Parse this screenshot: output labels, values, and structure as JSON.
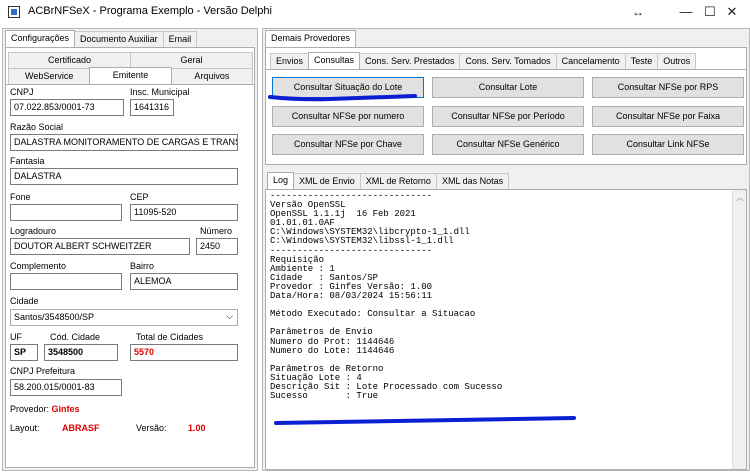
{
  "window": {
    "title": "ACBrNFSeX - Programa Exemplo - Versão Delphi",
    "resize_glyph": "↔",
    "minimize_glyph": "—",
    "maximize_glyph": "☐",
    "close_glyph": "✕"
  },
  "left": {
    "top_tabs": [
      "Configurações",
      "Documento Auxiliar",
      "Email"
    ],
    "sub_tabs_row1": [
      "Certificado",
      "Geral"
    ],
    "sub_tabs_row2": [
      "WebService",
      "Emitente",
      "Arquivos"
    ],
    "fields": {
      "cnpj_label": "CNPJ",
      "cnpj_value": "07.022.853/0001-73",
      "insc_label": "Insc. Municipal",
      "insc_value": "1641316",
      "razao_label": "Razão Social",
      "razao_value": "DALASTRA MONITORAMENTO DE CARGAS E TRANS",
      "fantasia_label": "Fantasia",
      "fantasia_value": "DALASTRA",
      "fone_label": "Fone",
      "fone_value": "",
      "cep_label": "CEP",
      "cep_value": "11095-520",
      "logradouro_label": "Logradouro",
      "logradouro_value": "DOUTOR ALBERT SCHWEITZER",
      "numero_label": "Número",
      "numero_value": "2450",
      "complemento_label": "Complemento",
      "complemento_value": "",
      "bairro_label": "Bairro",
      "bairro_value": "ALEMOA",
      "cidade_label": "Cidade",
      "cidade_value": "Santos/3548500/SP",
      "uf_label": "UF",
      "uf_value": "SP",
      "cod_cidade_label": "Cód. Cidade",
      "cod_cidade_value": "3548500",
      "total_cidades_label": "Total de Cidades",
      "total_cidades_value": "5570",
      "cnpj_pref_label": "CNPJ Prefeitura",
      "cnpj_pref_value": "58.200.015/0001-83",
      "provedor_label": "Provedor:",
      "provedor_value": "Ginfes",
      "layout_label": "Layout:",
      "layout_value": "ABRASF",
      "versao_label": "Versão:",
      "versao_value": "1.00"
    }
  },
  "right": {
    "top_tab": "Demais Provedores",
    "tabs": [
      "Envios",
      "Consultas",
      "Cons. Serv. Prestados",
      "Cons. Serv. Tomados",
      "Cancelamento",
      "Teste",
      "Outros"
    ],
    "buttons": [
      [
        "Consultar Situação do Lote",
        "Consultar Lote",
        "Consultar NFSe por RPS"
      ],
      [
        "Consultar NFSe por numero",
        "Consultar NFSe por Período",
        "Consultar NFSe por Faixa"
      ],
      [
        "Consultar NFSe por Chave",
        "Consultar NFSe Genérico",
        "Consultar Link NFSe"
      ]
    ],
    "log_tabs": [
      "Log",
      "XML de Envio",
      "XML de Retorno",
      "XML das Notas"
    ],
    "log_text": "------------------------------\nVersão OpenSSL\nOpenSSL 1.1.1j  16 Feb 2021\n01.01.01.0AF\nC:\\Windows\\SYSTEM32\\libcrypto-1_1.dll\nC:\\Windows\\SYSTEM32\\libssl-1_1.dll\n------------------------------\nRequisição\nAmbiente : 1\nCidade   : Santos/SP\nProvedor : Ginfes Versão: 1.00\nData/Hora: 08/03/2024 15:56:11\n\nMétodo Executado: Consultar a Situacao\n\nParâmetros de Envio\nNumero do Prot: 1144646\nNumero do Lote: 1144646\n\nParâmetros de Retorno\nSituação Lote : 4\nDescrição Sit : Lote Processado com Sucesso\nSucesso       : True"
  },
  "colors": {
    "annotation_blue": "#0b1fd0",
    "value_red": "#e00000"
  }
}
